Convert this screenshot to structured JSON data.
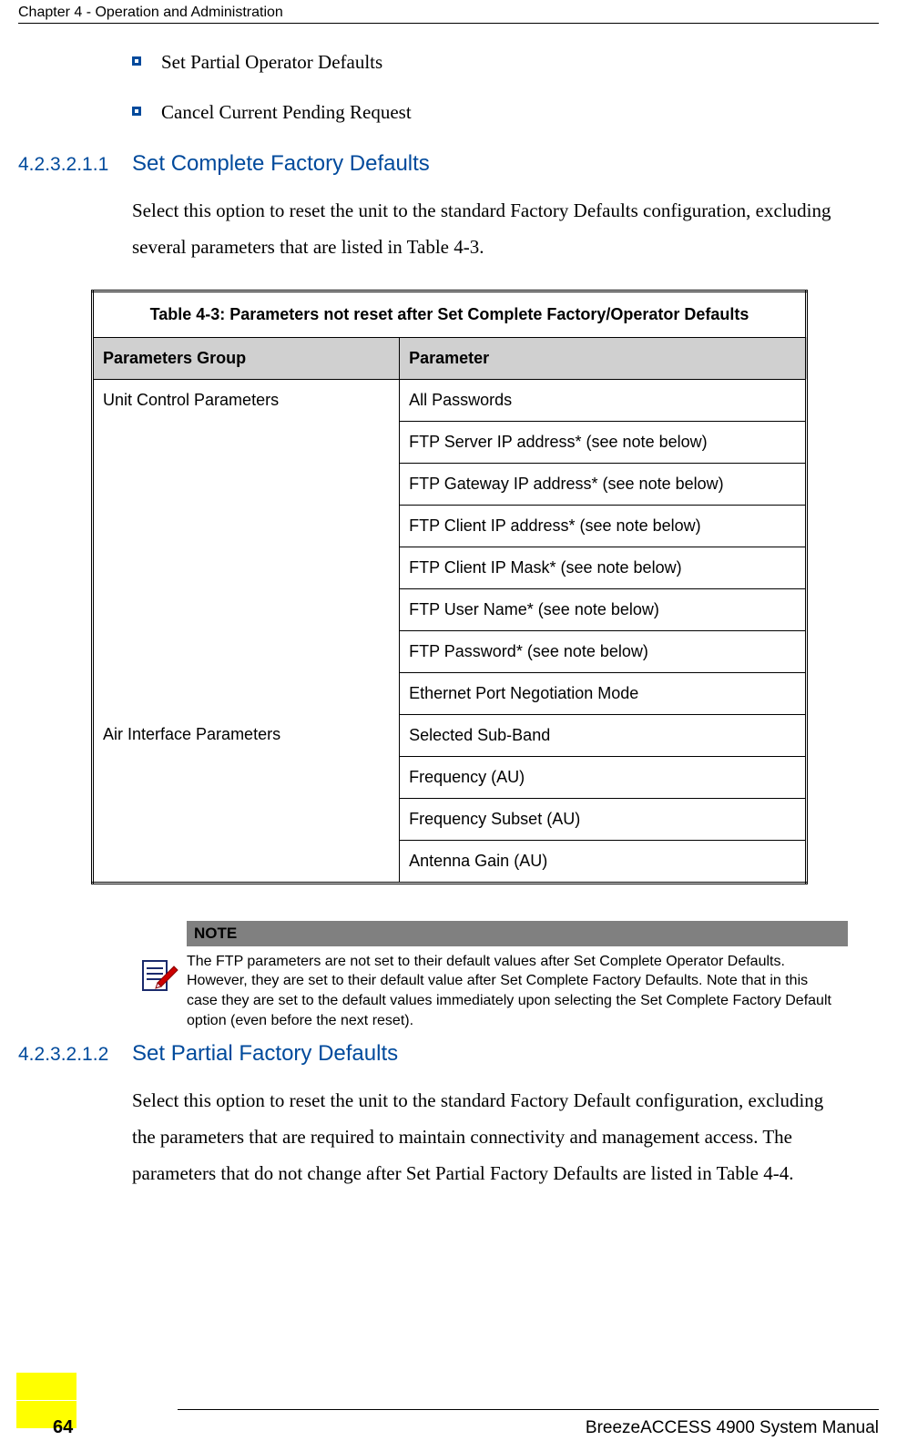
{
  "header": {
    "running_head": "Chapter 4 - Operation and Administration"
  },
  "bullets": {
    "b1": "Set Partial Operator Defaults",
    "b2": "Cancel Current Pending Request"
  },
  "sec1": {
    "num": "4.2.3.2.1.1",
    "title": "Set Complete Factory Defaults",
    "para": "Select this option to reset the unit to the standard Factory Defaults configuration, excluding several parameters that are listed in Table 4-3."
  },
  "table": {
    "caption": "Table 4-3: Parameters not reset after Set Complete Factory/Operator Defaults",
    "col1": "Parameters Group",
    "col2": "Parameter",
    "g1": "Unit Control Parameters",
    "g1p1": "All Passwords",
    "g1p2": "FTP Server IP address* (see note below)",
    "g1p3": "FTP Gateway IP address* (see note below)",
    "g1p4": "FTP Client IP address* (see note below)",
    "g1p5": "FTP Client IP Mask* (see note below)",
    "g1p6": "FTP User Name* (see note below)",
    "g1p7": "FTP Password* (see note below)",
    "g1p8": "Ethernet Port Negotiation Mode",
    "g2": "Air Interface Parameters",
    "g2p1": "Selected Sub-Band",
    "g2p2": "Frequency (AU)",
    "g2p3": "Frequency Subset (AU)",
    "g2p4": "Antenna Gain (AU)"
  },
  "note": {
    "label": "NOTE",
    "body": "The FTP parameters are not set to their default values after Set Complete Operator Defaults. However, they are set to their default value after Set Complete Factory Defaults. Note that in this case they are set to the default values immediately upon selecting the Set Complete Factory Default option (even before the next reset)."
  },
  "sec2": {
    "num": "4.2.3.2.1.2",
    "title": "Set Partial Factory Defaults",
    "para": "Select this option to reset the unit to the standard Factory Default configuration, excluding the parameters that are required to maintain connectivity and management access. The parameters that do not change after Set Partial Factory Defaults are listed in Table 4-4."
  },
  "footer": {
    "page": "64",
    "manual": "BreezeACCESS 4900 System Manual"
  }
}
